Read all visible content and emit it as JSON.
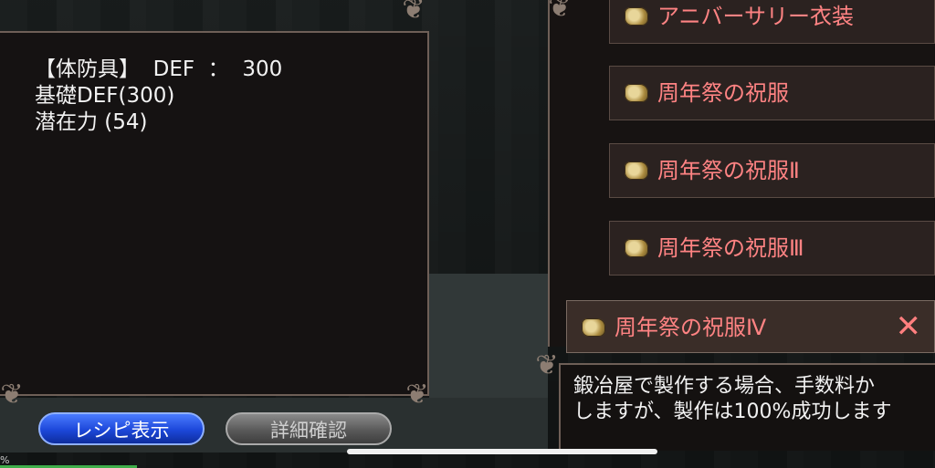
{
  "stats": {
    "line1": "【体防具】  DEF  ：  300",
    "line2": "基礎DEF(300)",
    "line3": "潜在力 (54)"
  },
  "buttons": {
    "recipe": "レシピ表示",
    "detail": "詳細確認"
  },
  "list": {
    "items": [
      {
        "label": "アニバーサリー衣装"
      },
      {
        "label": "周年祭の祝服"
      },
      {
        "label": "周年祭の祝服Ⅱ"
      },
      {
        "label": "周年祭の祝服Ⅲ"
      },
      {
        "label": "周年祭の祝服Ⅳ"
      }
    ],
    "close_symbol": "✕"
  },
  "message": {
    "line1": "鍛冶屋で製作する場合、手数料か",
    "line2": "しますが、製作は100%成功します"
  },
  "status": {
    "percent_symbol": "%"
  },
  "colors": {
    "item_text": "#ff8383",
    "panel_border": "#6e5f57",
    "recipe_button": "#1c47d9"
  }
}
